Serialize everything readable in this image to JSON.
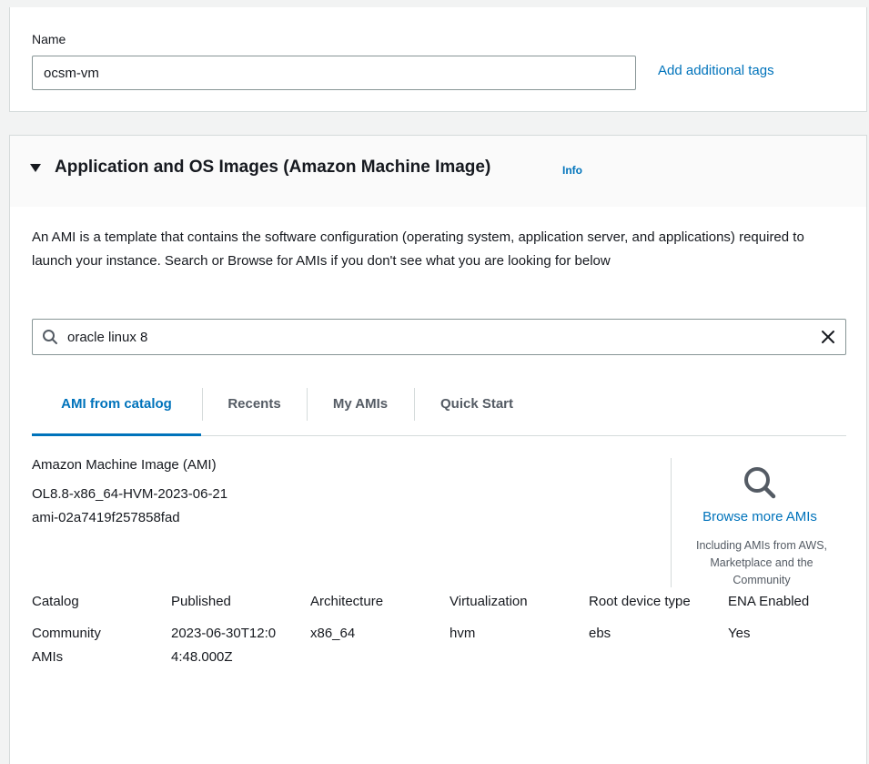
{
  "name_section": {
    "label": "Name",
    "value": "ocsm-vm",
    "add_tags_link": "Add additional tags"
  },
  "ami_section": {
    "title": "Application and OS Images (Amazon Machine Image)",
    "info_link": "Info",
    "description": "An AMI is a template that contains the software configuration (operating system, application server, and applications) required to launch your instance. Search or Browse for AMIs if you don't see what you are looking for below",
    "search": {
      "value": "oracle linux 8",
      "search_icon": "search-icon",
      "clear_icon": "close-icon"
    },
    "tabs": [
      {
        "label": "AMI from catalog",
        "active": true
      },
      {
        "label": "Recents",
        "active": false
      },
      {
        "label": "My AMIs",
        "active": false
      },
      {
        "label": "Quick Start",
        "active": false
      }
    ],
    "ami": {
      "type_label": "Amazon Machine Image (AMI)",
      "name": "OL8.8-x86_64-HVM-2023-06-21",
      "id": "ami-02a7419f257858fad"
    },
    "browse": {
      "icon": "magnifier-icon",
      "link": "Browse more AMIs",
      "subtext": "Including AMIs from AWS, Marketplace and the Community"
    },
    "details": {
      "headers": [
        "Catalog",
        "Published",
        "Architecture",
        "Virtualization",
        "Root device type",
        "ENA Enabled"
      ],
      "values": [
        "Community AMIs",
        "2023-06-30T12:04:48.000Z",
        "x86_64",
        "hvm",
        "ebs",
        "Yes"
      ]
    }
  },
  "colors": {
    "link": "#0073bb",
    "text": "#16191f",
    "border": "#d5dbdb",
    "page_bg": "#f2f3f3"
  }
}
